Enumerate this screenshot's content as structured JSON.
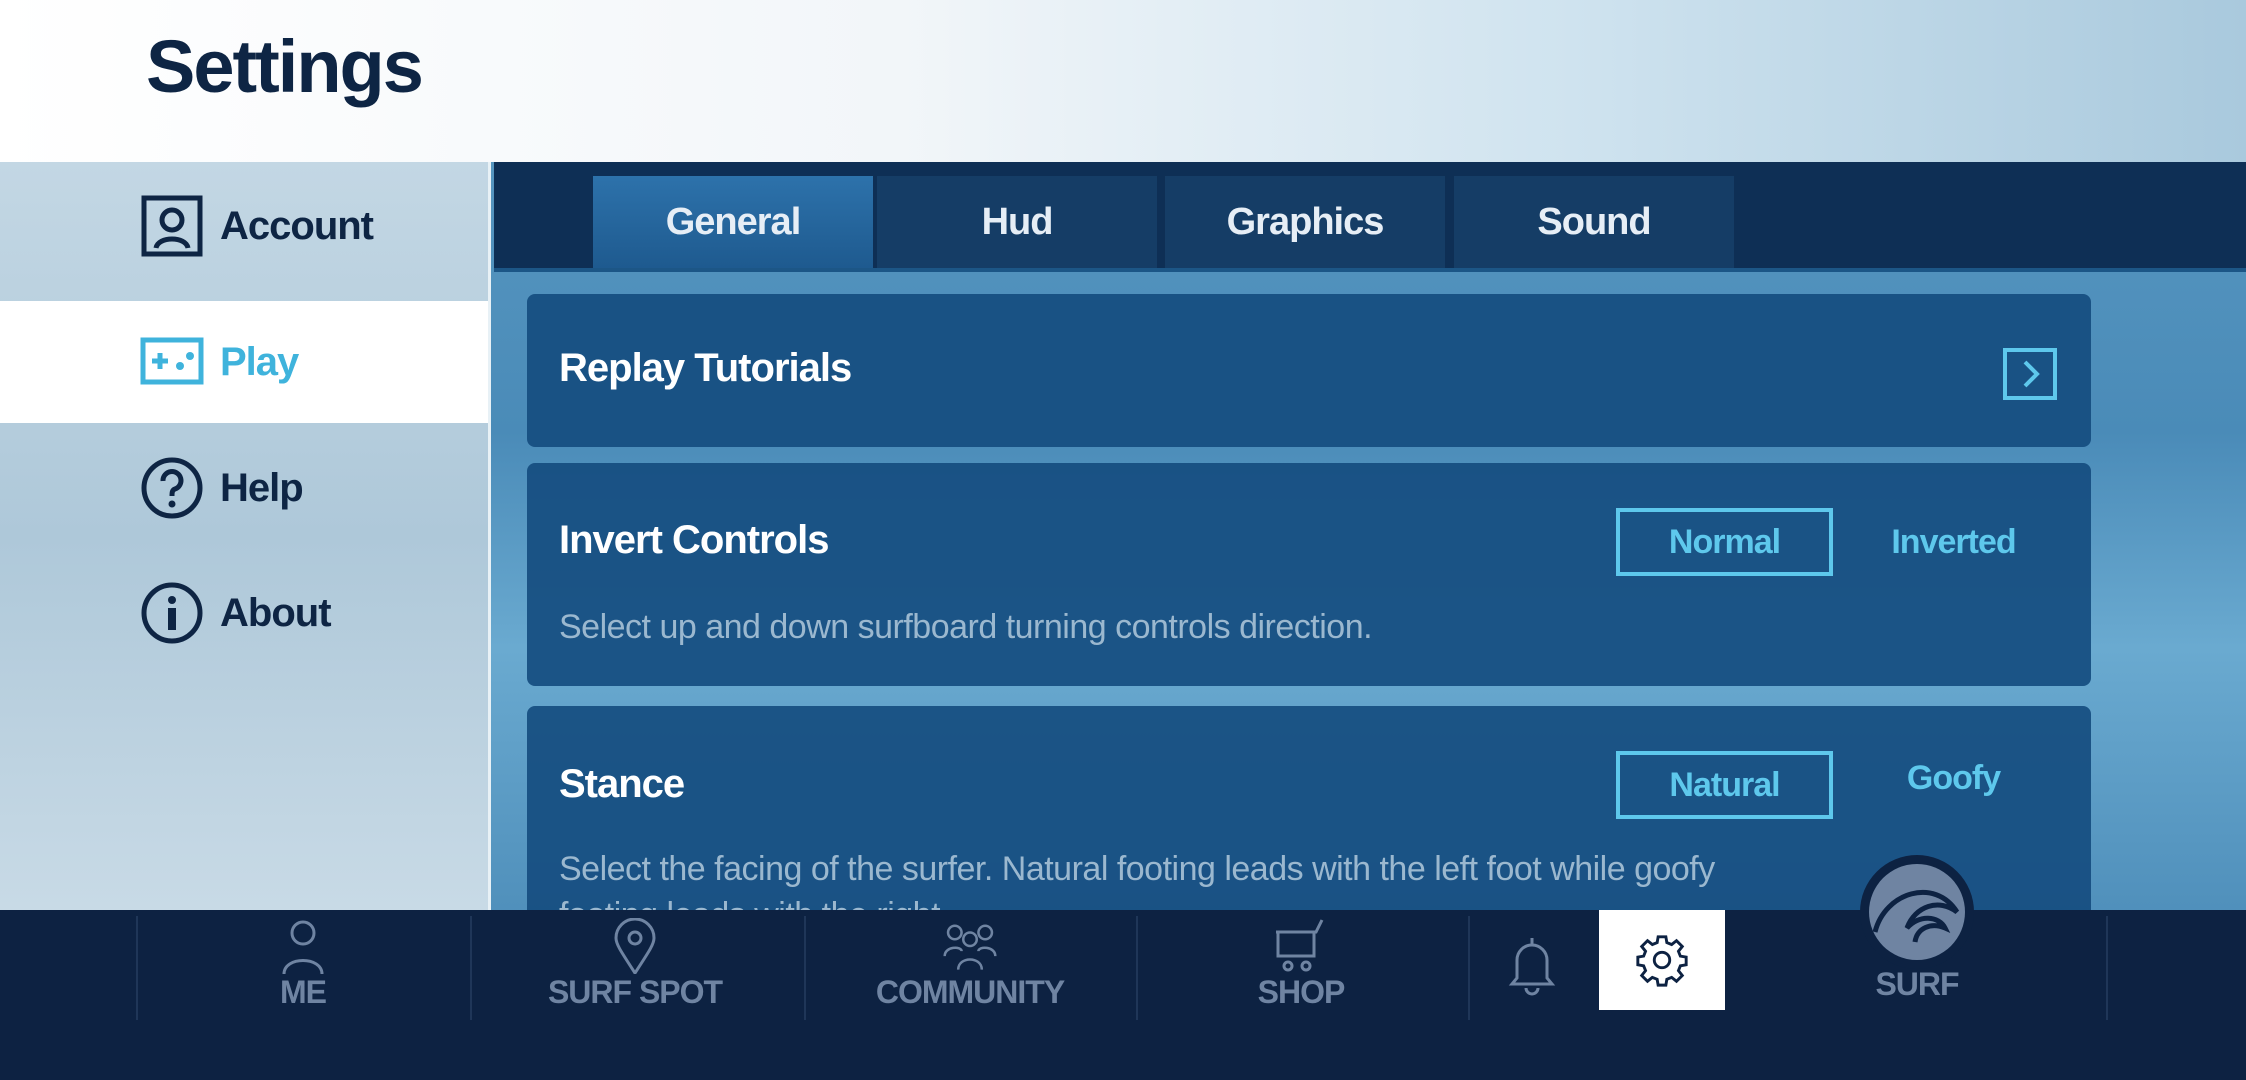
{
  "header": {
    "title": "Settings"
  },
  "sidebar": {
    "items": [
      {
        "label": "Account",
        "icon": "account-icon",
        "active": false
      },
      {
        "label": "Play",
        "icon": "gamepad-icon",
        "active": true
      },
      {
        "label": "Help",
        "icon": "help-icon",
        "active": false
      },
      {
        "label": "About",
        "icon": "info-icon",
        "active": false
      }
    ]
  },
  "tabs": [
    {
      "label": "General",
      "active": true
    },
    {
      "label": "Hud"
    },
    {
      "label": "Graphics"
    },
    {
      "label": "Sound"
    }
  ],
  "settings": {
    "replay": {
      "title": "Replay Tutorials"
    },
    "invert": {
      "title": "Invert Controls",
      "desc": "Select up and down surfboard turning controls direction.",
      "options": [
        "Normal",
        "Inverted"
      ],
      "selected": "Normal"
    },
    "stance": {
      "title": "Stance",
      "desc": "Select the facing of the surfer. Natural footing leads with the left foot while goofy",
      "desc2": "footing leads with the right.",
      "options": [
        "Natural",
        "Goofy"
      ],
      "selected": "Natural"
    }
  },
  "nav": {
    "items": [
      {
        "label": "ME"
      },
      {
        "label": "SURF SPOT"
      },
      {
        "label": "COMMUNITY"
      },
      {
        "label": "SHOP"
      },
      {
        "label": "SURF"
      }
    ]
  },
  "colors": {
    "accent": "#5ec8ec",
    "navy": "#0d2242",
    "title": "#0e2544"
  }
}
